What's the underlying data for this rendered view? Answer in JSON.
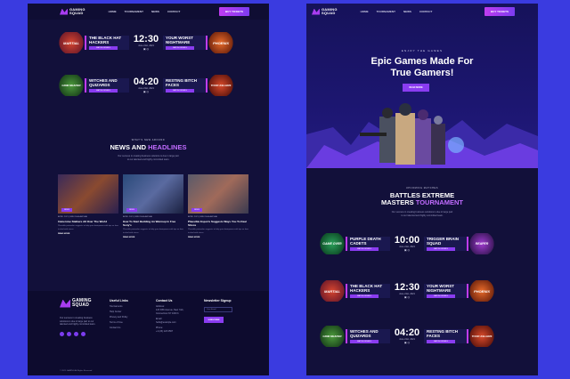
{
  "brand": {
    "line1": "GAMING",
    "line2": "SQUAD",
    "accent": "#a83cf0",
    "background": "#3a3be0"
  },
  "left": {
    "nav": {
      "links": [
        "HOME",
        "TOURNAMENT",
        "NEWS",
        "CONTACT"
      ],
      "cta": "BUY TICKETS"
    },
    "matches": [
      {
        "team_a": "THE BLACK HAT HACKERS",
        "team_a_logo": "MARTIAL",
        "time": "12:30",
        "date": "June 21st, 2021",
        "team_b": "YOUR WORST NIGHTMARE",
        "team_b_logo": "PHOENIX",
        "btn": "MATCH DETAILS"
      },
      {
        "team_a": "WITCHES AND QUIZARDS",
        "team_a_logo": "GRIM REAPER",
        "time": "04:20",
        "date": "June 21st, 2021",
        "team_b": "RESTING BITCH FACES",
        "team_b_logo": "TOXIC KILLERS",
        "btn": "MATCH DETAILS"
      }
    ],
    "news": {
      "subtitle": "WHAT'S NEW AROUND",
      "title_plain": "NEWS AND ",
      "title_accent": "HEADLINES",
      "desc_line1": "Our success in creating business solutions is due in large part",
      "desc_line2": "to our talented and highly committed team.",
      "cards": [
        {
          "tag": "NEWS",
          "meta": "APRIL 2021  |  BRUCE ALAMOHAI",
          "title": "Immersive Stalkers All Over The World",
          "text": "Plausible pretender suggests to help your brainpower with tips on how to deal with stress.",
          "more": "READ MORE"
        },
        {
          "tag": "NEWS",
          "meta": "APRIL 2021  |  BRUCE ALAMOHAI",
          "title": "How To Start Building An Warmup In Free Sony's",
          "text": "Plausible pretender suggests to help your brainpower with tips on how to deal with stress.",
          "more": "READ MORE"
        },
        {
          "tag": "NEWS",
          "meta": "APRIL 2021  |  BRUCE ALAMOHAI",
          "title": "Plausible Esports Suggests Ways You To Deal Stress",
          "text": "Plausible pretender suggests to help your brainpower with tips on how to deal with stress.",
          "more": "READ MORE"
        }
      ]
    },
    "footer": {
      "desc": "Our success in creating business solutions is due in large part to our talented and highly committed team.",
      "col1_head": "Useful Links",
      "col1_items": [
        "Tournaments",
        "Help Center",
        "Privacy and Policy",
        "Terms of Use",
        "Contact Us"
      ],
      "col2_head": "Contact Us",
      "col2_items": [
        "Address:",
        "123 Fifth Avenue, New York,",
        "Connecticut NY 1000 b",
        "Email:",
        "hello@example.com",
        "Phone:",
        "+1 (23) 123 4567"
      ],
      "col3_head": "Newsletter Signup",
      "email_placeholder": "Your Email",
      "submit": "SUBSCRIBE",
      "copyright": "© 2021 GAMING All Rights Reserved"
    }
  },
  "right": {
    "nav": {
      "links": [
        "HOME",
        "TOURNAMENT",
        "NEWS",
        "CONTACT"
      ],
      "cta": "BUY TICKETS"
    },
    "hero": {
      "subtitle": "ENJOY THE GAMES",
      "title_line1": "Epic Games Made For",
      "title_line2": "True Gamers!",
      "cta": "READ MORE"
    },
    "tournament": {
      "subtitle": "UPCOMING MATCHES",
      "title_line1": "BATTLES EXTREME",
      "title_plain": "MASTERS ",
      "title_accent": "TOURNAMENT",
      "desc_line1": "Our success in creating business solutions is due in large part",
      "desc_line2": "to our talented and highly committed team.",
      "matches": [
        {
          "team_a": "PURPLE DEATH CADETS",
          "team_a_logo": "GAME OVER",
          "time": "10:00",
          "date": "June 21st, 2021",
          "team_b": "TRIGGER BRAIN SQUAD",
          "team_b_logo": "REAPER",
          "btn": "MATCH DETAILS"
        },
        {
          "team_a": "THE BLACK HAT HACKERS",
          "team_a_logo": "MARTIAL",
          "time": "12:30",
          "date": "June 21st, 2021",
          "team_b": "YOUR WORST NIGHTMARE",
          "team_b_logo": "PHOENIX",
          "btn": "MATCH DETAILS"
        },
        {
          "team_a": "WITCHES AND QUIZARDS",
          "team_a_logo": "GRIM REAPER",
          "time": "04:20",
          "date": "June 21st, 2021",
          "team_b": "RESTING BITCH FACES",
          "team_b_logo": "TOXIC KILLERS",
          "btn": "MATCH DETAILS"
        }
      ]
    }
  }
}
